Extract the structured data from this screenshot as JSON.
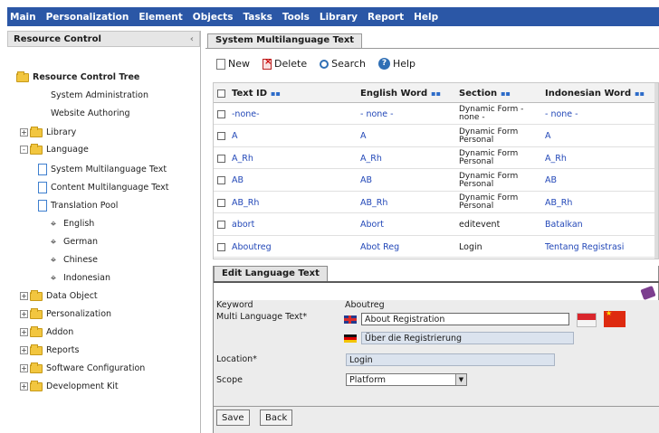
{
  "menu": [
    "Main",
    "Personalization",
    "Element",
    "Objects",
    "Tasks",
    "Tools",
    "Library",
    "Report",
    "Help"
  ],
  "left_panel": {
    "title": "Resource Control",
    "collapse_glyph": "‹",
    "tree": [
      {
        "label": "Resource Control Tree",
        "icon": "folder-open-icon",
        "bold": true
      },
      {
        "label": "System Administration",
        "icon": "none"
      },
      {
        "label": "Website Authoring",
        "icon": "none"
      },
      {
        "label": "Library",
        "icon": "folder-icon"
      },
      {
        "label": "Language",
        "icon": "folder-open-icon"
      },
      {
        "label": "System Multilanguage Text",
        "icon": "document-icon"
      },
      {
        "label": "Content Multilanguage Text",
        "icon": "document-icon"
      },
      {
        "label": "Translation Pool",
        "icon": "document-icon"
      },
      {
        "label": "English",
        "icon": "globe-icon"
      },
      {
        "label": "German",
        "icon": "globe-icon"
      },
      {
        "label": "Chinese",
        "icon": "globe-icon"
      },
      {
        "label": "Indonesian",
        "icon": "globe-icon"
      },
      {
        "label": "Data Object",
        "icon": "folder-icon"
      },
      {
        "label": "Personalization",
        "icon": "folder-icon"
      },
      {
        "label": "Addon",
        "icon": "folder-icon"
      },
      {
        "label": "Reports",
        "icon": "folder-icon"
      },
      {
        "label": "Software Configuration",
        "icon": "folder-icon"
      },
      {
        "label": "Development Kit",
        "icon": "folder-icon"
      }
    ]
  },
  "main_tab": "System Multilanguage Text",
  "toolbar": {
    "new": "New",
    "delete": "Delete",
    "search": "Search",
    "help": "Help"
  },
  "grid": {
    "columns": [
      "Text ID",
      "English Word",
      "Section",
      "Indonesian Word"
    ],
    "sort_glyph": "▪▪",
    "rows": [
      {
        "id": "-none-",
        "en": "- none -",
        "section": "Dynamic Form - none -",
        "ind": "- none -"
      },
      {
        "id": "A",
        "en": "A",
        "section": "Dynamic Form Personal",
        "ind": "A"
      },
      {
        "id": "A_Rh",
        "en": "A_Rh",
        "section": "Dynamic Form Personal",
        "ind": "A_Rh"
      },
      {
        "id": "AB",
        "en": "AB",
        "section": "Dynamic Form Personal",
        "ind": "AB"
      },
      {
        "id": "AB_Rh",
        "en": "AB_Rh",
        "section": "Dynamic Form Personal",
        "ind": "AB_Rh"
      },
      {
        "id": "abort",
        "en": "Abort",
        "section": "editevent",
        "ind": "Batalkan"
      },
      {
        "id": "Aboutreg",
        "en": "Abot Reg",
        "section": "Login",
        "ind": "Tentang Registrasi"
      }
    ]
  },
  "edit_tab": "Edit Language Text",
  "form": {
    "keyword_label": "Keyword",
    "keyword_value": "Aboutreg",
    "multi_label": "Multi Language Text*",
    "english_text": "About Registration",
    "german_text": "Über die Registrierung",
    "location_label": "Location*",
    "location_value": "Login",
    "scope_label": "Scope",
    "scope_value": "Platform"
  },
  "buttons": {
    "save": "Save",
    "back": "Back"
  }
}
